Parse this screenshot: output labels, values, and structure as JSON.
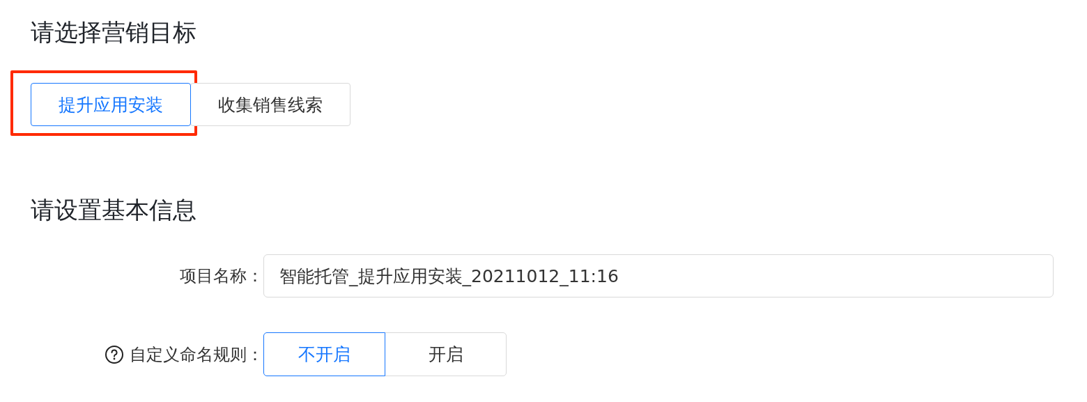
{
  "goal_section": {
    "title": "请选择营销目标",
    "options": [
      {
        "label": "提升应用安装",
        "selected": true,
        "highlighted": true
      },
      {
        "label": "收集销售线索",
        "selected": false,
        "highlighted": false
      }
    ]
  },
  "basic_info_section": {
    "title": "请设置基本信息",
    "project_name": {
      "label": "项目名称：",
      "value": "智能托管_提升应用安装_20211012_11:16"
    },
    "naming_rule": {
      "label": "自定义命名规则：",
      "options": [
        {
          "label": "不开启",
          "selected": true
        },
        {
          "label": "开启",
          "selected": false
        }
      ]
    }
  }
}
